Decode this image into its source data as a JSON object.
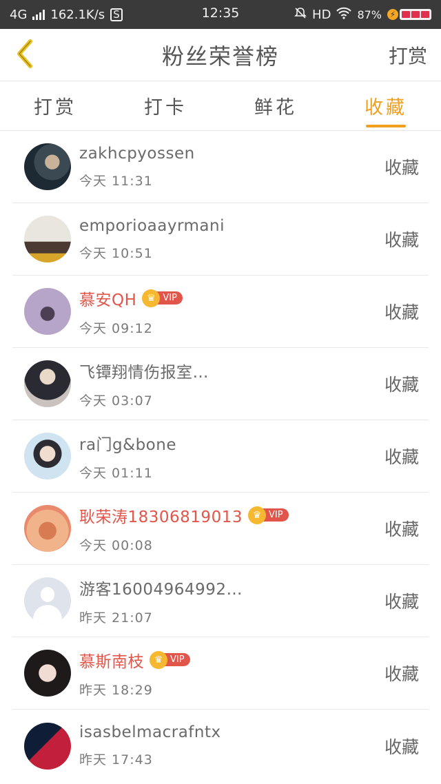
{
  "status_bar": {
    "network": "4G",
    "speed": "162.1K/s",
    "time": "12:35",
    "hd": "HD",
    "battery": "87%"
  },
  "header": {
    "title": "粉丝荣誉榜",
    "action_label": "打赏"
  },
  "tabs": [
    {
      "label": "打赏",
      "active": false
    },
    {
      "label": "打卡",
      "active": false
    },
    {
      "label": "鲜花",
      "active": false
    },
    {
      "label": "收藏",
      "active": true
    }
  ],
  "vip_label": "VIP",
  "colors": {
    "accent": "#f0a020",
    "vip_name": "#e2554a"
  },
  "rows": [
    {
      "name": "zakhcpyossen",
      "time": "今天 11:31",
      "vip": false,
      "action": "收藏"
    },
    {
      "name": "emporioaayrmani",
      "time": "今天 10:51",
      "vip": false,
      "action": "收藏"
    },
    {
      "name": "慕安QH",
      "time": "今天 09:12",
      "vip": true,
      "action": "收藏"
    },
    {
      "name": "飞镡翔情伤报室…",
      "time": "今天 03:07",
      "vip": false,
      "action": "收藏"
    },
    {
      "name": "ra门g&bone",
      "time": "今天 01:11",
      "vip": false,
      "action": "收藏"
    },
    {
      "name": "耿荣涛18306819013",
      "time": "今天 00:08",
      "vip": true,
      "action": "收藏"
    },
    {
      "name": "游客16004964992…",
      "time": "昨天 21:07",
      "vip": false,
      "action": "收藏"
    },
    {
      "name": "慕斯南枝",
      "time": "昨天 18:29",
      "vip": true,
      "action": "收藏"
    },
    {
      "name": "isasbelmacrafntx",
      "time": "昨天 17:43",
      "vip": false,
      "action": "收藏"
    }
  ]
}
